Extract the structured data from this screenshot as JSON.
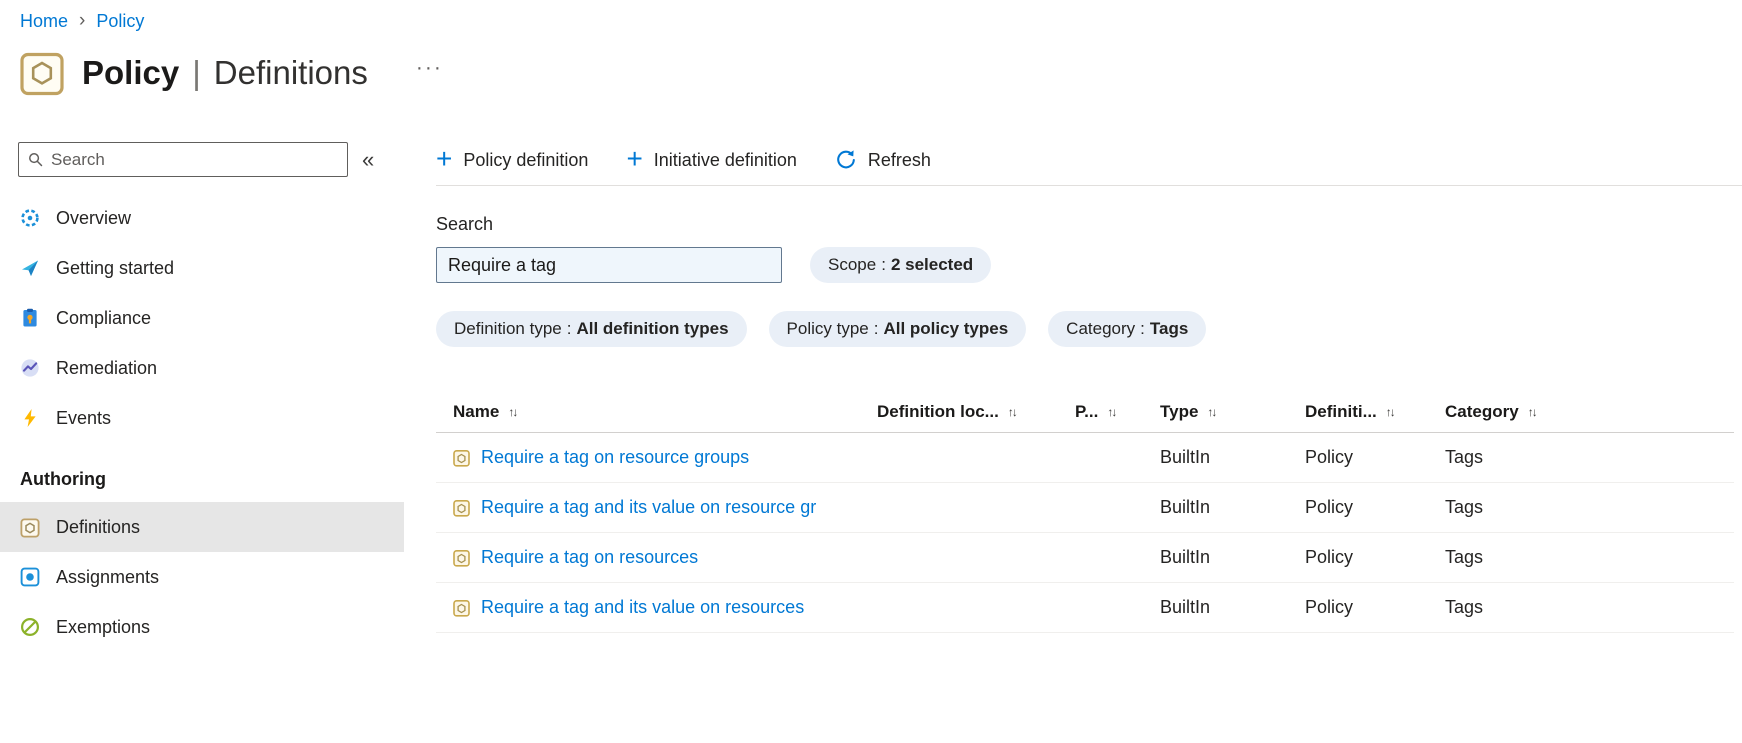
{
  "colors": {
    "accent": "#0078d4",
    "link": "#0078d4",
    "text": "#252423",
    "pill-bg": "#e9eff7",
    "input-bg": "#eff6fc",
    "selected-bg": "#e6e6e6",
    "divider": "#e1dfdd"
  },
  "breadcrumb": {
    "home": "Home",
    "separator": "›",
    "policy": "Policy"
  },
  "header": {
    "title_primary": "Policy",
    "title_separator": "|",
    "title_secondary": "Definitions",
    "more": "···"
  },
  "sidebar": {
    "search": {
      "placeholder": "Search"
    },
    "collapse": "«",
    "items": [
      {
        "label": "Overview"
      },
      {
        "label": "Getting started"
      },
      {
        "label": "Compliance"
      },
      {
        "label": "Remediation"
      },
      {
        "label": "Events"
      }
    ],
    "section_label": "Authoring",
    "authoring_items": [
      {
        "label": "Definitions",
        "selected": true
      },
      {
        "label": "Assignments",
        "selected": false
      },
      {
        "label": "Exemptions",
        "selected": false
      }
    ]
  },
  "toolbar": {
    "policy_definition": "Policy definition",
    "initiative_definition": "Initiative definition",
    "refresh": "Refresh"
  },
  "filters": {
    "search_label": "Search",
    "search_value": "Require a tag",
    "pill_separator": ":",
    "pills": [
      {
        "name": "Scope",
        "value": "2 selected"
      },
      {
        "name": "Definition type",
        "value": "All definition types"
      },
      {
        "name": "Policy type",
        "value": "All policy types"
      },
      {
        "name": "Category",
        "value": "Tags"
      }
    ]
  },
  "table": {
    "sort_glyph": "↑↓",
    "columns": [
      {
        "label": "Name"
      },
      {
        "label": "Definition loc..."
      },
      {
        "label": "P..."
      },
      {
        "label": "Type"
      },
      {
        "label": "Definiti..."
      },
      {
        "label": "Category"
      }
    ],
    "rows": [
      {
        "name": "Require a tag on resource groups",
        "definition_location": "",
        "policies": "",
        "type": "BuiltIn",
        "definition_type": "Policy",
        "category": "Tags"
      },
      {
        "name": "Require a tag and its value on resource gr",
        "definition_location": "",
        "policies": "",
        "type": "BuiltIn",
        "definition_type": "Policy",
        "category": "Tags"
      },
      {
        "name": "Require a tag on resources",
        "definition_location": "",
        "policies": "",
        "type": "BuiltIn",
        "definition_type": "Policy",
        "category": "Tags"
      },
      {
        "name": "Require a tag and its value on resources",
        "definition_location": "",
        "policies": "",
        "type": "BuiltIn",
        "definition_type": "Policy",
        "category": "Tags"
      }
    ]
  }
}
